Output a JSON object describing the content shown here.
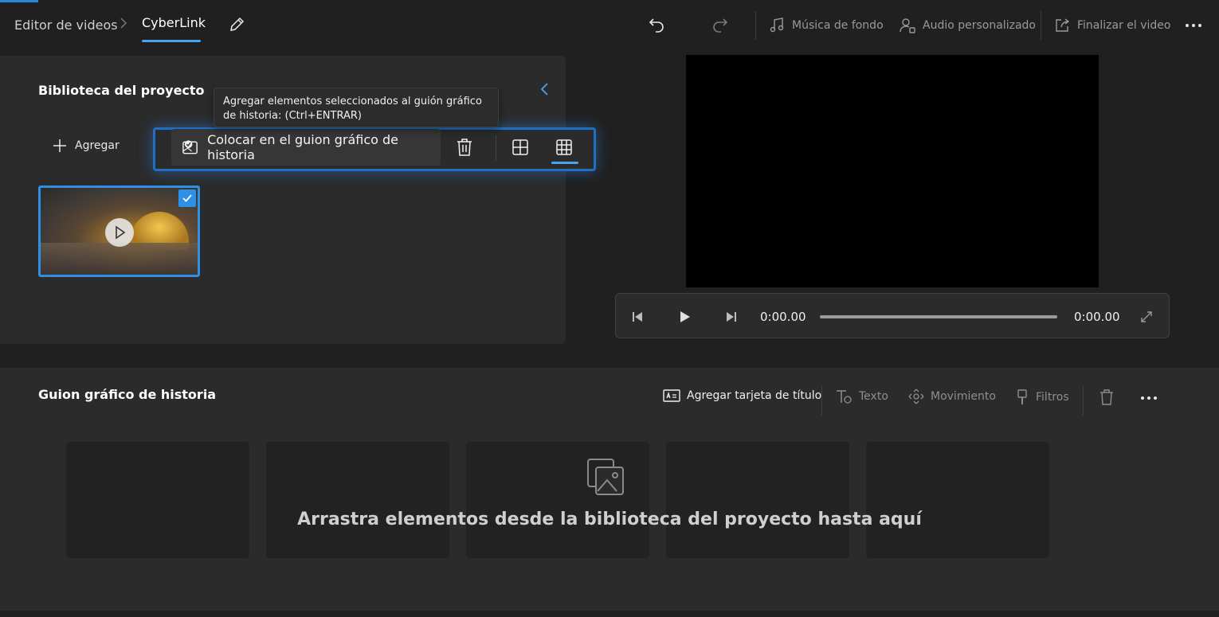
{
  "breadcrumb": {
    "root": "Editor de videos",
    "current": "CyberLink"
  },
  "toolbar": {
    "background_music": "Música de fondo",
    "custom_audio": "Audio personalizado",
    "finish_video": "Finalizar el video"
  },
  "library": {
    "title": "Biblioteca del proyecto",
    "add_label": "Agregar",
    "tooltip": "Agregar elementos seleccionados al guión gráfico de historia: (Ctrl+ENTRAR)",
    "place_label": "Colocar en el guion gráfico de historia"
  },
  "player": {
    "current_time": "0:00.00",
    "total_time": "0:00.00"
  },
  "storyboard": {
    "title": "Guion gráfico de historia",
    "add_title_card": "Agregar tarjeta de título",
    "text": "Texto",
    "motion": "Movimiento",
    "filters": "Filtros",
    "empty_message": "Arrastra elementos desde la biblioteca del proyecto hasta aquí"
  },
  "colors": {
    "accent": "#2e8fe6",
    "background": "#202020",
    "panel": "#2b2b2b"
  }
}
